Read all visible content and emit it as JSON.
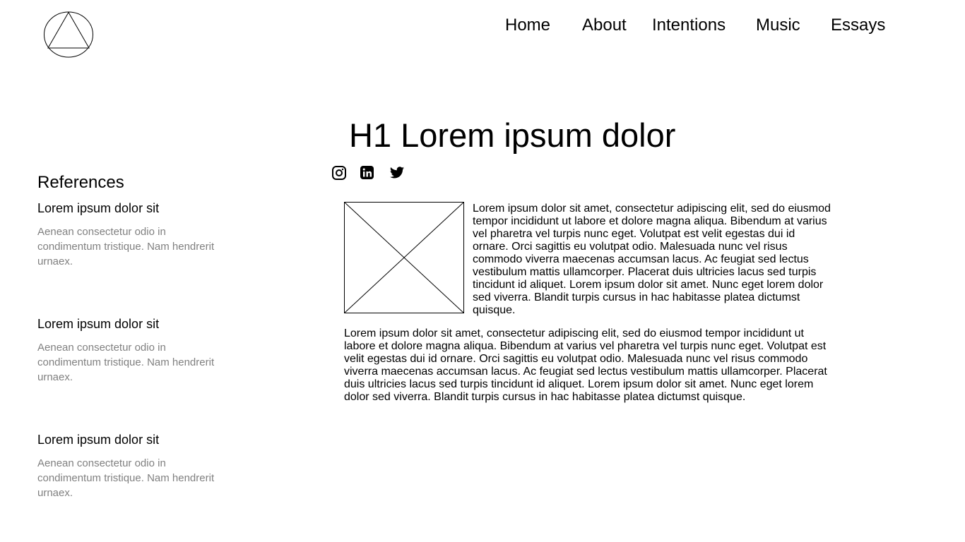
{
  "nav": {
    "items": [
      {
        "label": "Home"
      },
      {
        "label": "About"
      },
      {
        "label": "Intentions"
      },
      {
        "label": "Music"
      },
      {
        "label": "Essays"
      }
    ]
  },
  "logo": {
    "icon": "triangle-in-circle-icon"
  },
  "main": {
    "title": "H1 Lorem ipsum dolor",
    "social": [
      "instagram-icon",
      "linkedin-icon",
      "twitter-icon"
    ],
    "paragraph_1": "Lorem ipsum dolor sit amet, consectetur adipiscing elit, sed do eiusmod tempor incididunt ut labore et dolore magna aliqua. Bibendum at varius vel pharetra vel turpis nunc eget. Volutpat est velit egestas dui id ornare. Orci sagittis eu volutpat odio. Malesuada nunc vel risus commodo viverra maecenas accumsan lacus. Ac feugiat sed lectus vestibulum mattis ullamcorper. Placerat duis ultricies lacus sed turpis tincidunt id aliquet. Lorem ipsum dolor sit amet. Nunc eget lorem dolor sed viverra. Blandit turpis cursus in hac habitasse platea dictumst quisque.",
    "paragraph_2": "Lorem ipsum dolor sit amet, consectetur adipiscing elit, sed do eiusmod tempor incididunt ut labore et dolore magna aliqua. Bibendum at varius vel pharetra vel turpis nunc eget. Volutpat est velit egestas dui id ornare. Orci sagittis eu volutpat odio. Malesuada nunc vel risus commodo viverra maecenas accumsan lacus. Ac feugiat sed lectus vestibulum mattis ullamcorper. Placerat duis ultricies lacus sed turpis tincidunt id aliquet. Lorem ipsum dolor sit amet. Nunc eget lorem dolor sed viverra. Blandit turpis cursus in hac habitasse platea dictumst quisque."
  },
  "sidebar": {
    "heading": "References",
    "items": [
      {
        "title": "Lorem ipsum dolor sit",
        "description": "Aenean consectetur odio in condimentum tristique. Nam hendrerit urnaex."
      },
      {
        "title": "Lorem ipsum dolor sit",
        "description": "Aenean consectetur odio in condimentum tristique. Nam hendrerit urnaex."
      },
      {
        "title": "Lorem ipsum dolor sit",
        "description": "Aenean consectetur odio in condimentum tristique. Nam hendrerit urnaex."
      }
    ]
  },
  "colors": {
    "text": "#000000",
    "muted_text": "#808080",
    "background": "#ffffff"
  }
}
